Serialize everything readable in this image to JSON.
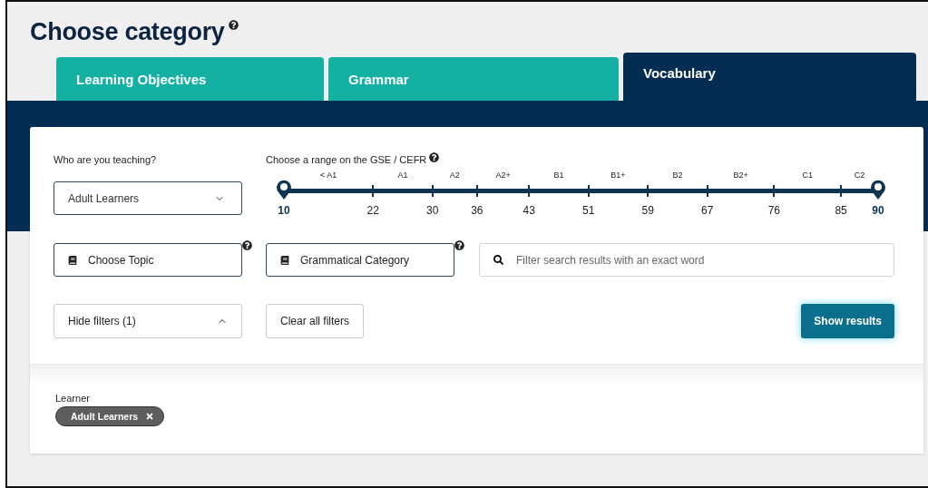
{
  "title": "Choose category",
  "tabs": [
    {
      "label": "Learning Objectives",
      "selected": false
    },
    {
      "label": "Grammar",
      "selected": false
    },
    {
      "label": "Vocabulary",
      "selected": true
    }
  ],
  "audience": {
    "label": "Who are you teaching?",
    "value": "Adult Learners"
  },
  "range": {
    "label": "Choose a range on the GSE / CEFR",
    "bands": [
      "< A1",
      "A1",
      "A2",
      "A2+",
      "B1",
      "B1+",
      "B2",
      "B2+",
      "C1",
      "C2"
    ],
    "scale": [
      {
        "value": "10",
        "selected": true
      },
      {
        "value": "22",
        "selected": false
      },
      {
        "value": "30",
        "selected": false
      },
      {
        "value": "36",
        "selected": false
      },
      {
        "value": "43",
        "selected": false
      },
      {
        "value": "51",
        "selected": false
      },
      {
        "value": "59",
        "selected": false
      },
      {
        "value": "67",
        "selected": false
      },
      {
        "value": "76",
        "selected": false
      },
      {
        "value": "85",
        "selected": false
      },
      {
        "value": "90",
        "selected": true
      }
    ],
    "handles": [
      {
        "level": 0
      },
      {
        "level": 1
      }
    ]
  },
  "topic": {
    "label": "Choose Topic"
  },
  "grammar": {
    "label": "Grammatical Category"
  },
  "search": {
    "placeholder": "Filter search results with an exact word"
  },
  "filters_toggle": {
    "label": "Hide filters (1)",
    "expanded": true
  },
  "clear_button": "Clear all filters",
  "show_button": "Show results",
  "active_filters": [
    {
      "group": "Learner",
      "chips": [
        "Adult Learners"
      ]
    }
  ]
}
